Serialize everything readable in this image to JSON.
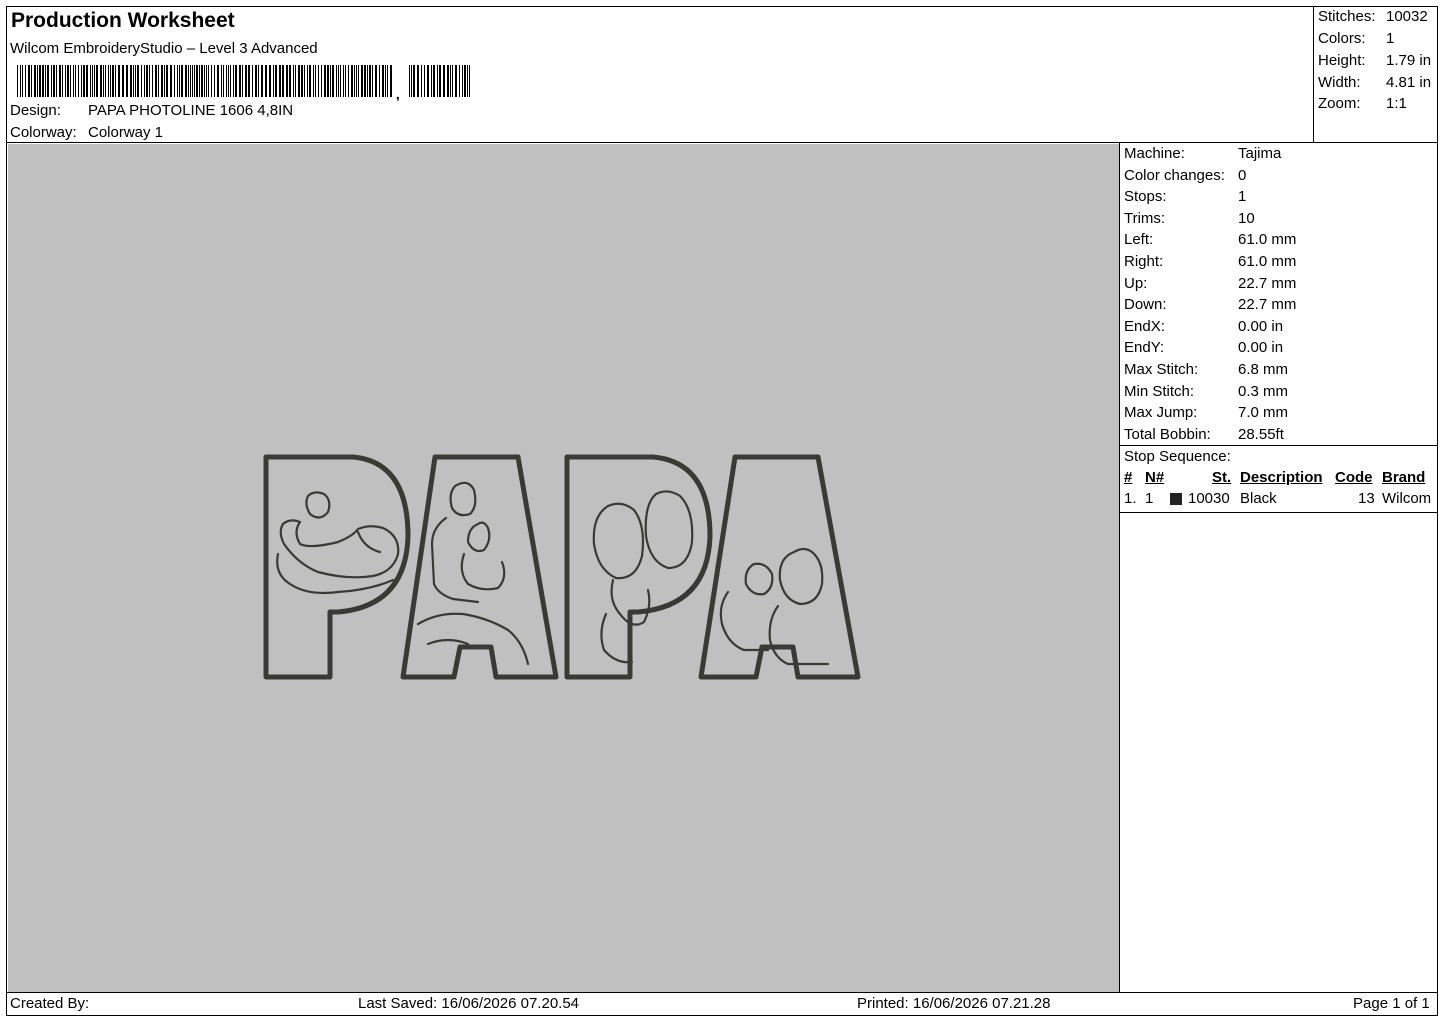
{
  "header": {
    "title": "Production Worksheet",
    "subtitle": "Wilcom EmbroideryStudio – Level 3 Advanced",
    "barcode_comma": ",",
    "design_label": "Design:",
    "design_value": "PAPA PHOTOLINE 1606 4,8IN",
    "colorway_label": "Colorway:",
    "colorway_value": "Colorway 1"
  },
  "stats": [
    {
      "label": "Stitches:",
      "value": "10032"
    },
    {
      "label": "Colors:",
      "value": "1"
    },
    {
      "label": "Height:",
      "value": "1.79 in"
    },
    {
      "label": "Width:",
      "value": "4.81 in"
    },
    {
      "label": "Zoom:",
      "value": "1:1"
    }
  ],
  "machine_info": [
    {
      "label": "Machine:",
      "value": "Tajima"
    },
    {
      "label": "Color changes:",
      "value": "0"
    },
    {
      "label": "Stops:",
      "value": "1"
    },
    {
      "label": "Trims:",
      "value": "10"
    },
    {
      "label": "Left:",
      "value": "61.0 mm"
    },
    {
      "label": "Right:",
      "value": "61.0 mm"
    },
    {
      "label": "Up:",
      "value": "22.7 mm"
    },
    {
      "label": "Down:",
      "value": "22.7 mm"
    },
    {
      "label": "EndX:",
      "value": "0.00 in"
    },
    {
      "label": "EndY:",
      "value": "0.00 in"
    },
    {
      "label": "Max Stitch:",
      "value": "6.8 mm"
    },
    {
      "label": "Min Stitch:",
      "value": "0.3 mm"
    },
    {
      "label": "Max Jump:",
      "value": "7.0 mm"
    },
    {
      "label": "Total Bobbin:",
      "value": "28.55ft"
    }
  ],
  "stop_sequence": {
    "title": "Stop Sequence:",
    "headers": {
      "num": "#",
      "n": "N#",
      "st": "St.",
      "description": "Description",
      "code": "Code",
      "brand": "Brand"
    },
    "rows": [
      {
        "num": "1.",
        "n": "1",
        "st": "10030",
        "description": "Black",
        "code": "13",
        "brand": "Wilcom",
        "color": "#222222"
      }
    ]
  },
  "footer": {
    "created_by": "Created By:",
    "last_saved": "Last Saved: 16/06/2026 07.20.54",
    "printed": "Printed: 16/06/2026 07.21.28",
    "page": "Page 1 of 1"
  },
  "design_preview": {
    "canvas_color": "#c0c0c0",
    "thread_color": "#3a3a35",
    "letters": "PAPA"
  }
}
